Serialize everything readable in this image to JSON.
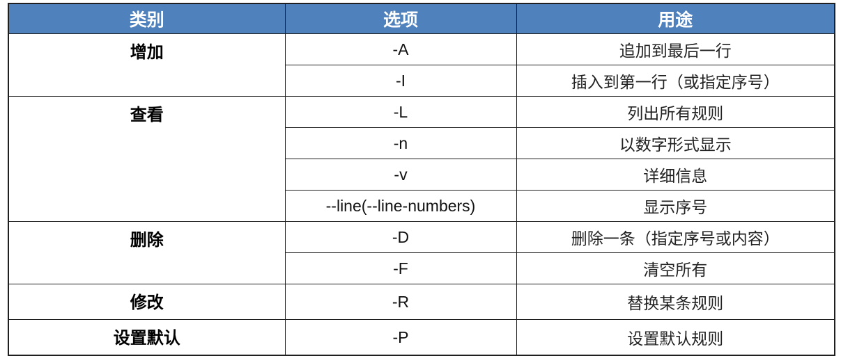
{
  "table": {
    "headers": [
      "类别",
      "选项",
      "用途"
    ],
    "colors": {
      "header_bg": "#4f81bd",
      "header_text": "#ffffff",
      "border": "#1f1f1f"
    },
    "groups": [
      {
        "category": "增加",
        "rows": [
          {
            "option": "-A",
            "purpose": "追加到最后一行"
          },
          {
            "option": "-I",
            "purpose": "插入到第一行（或指定序号）"
          }
        ]
      },
      {
        "category": "查看",
        "rows": [
          {
            "option": "-L",
            "purpose": "列出所有规则"
          },
          {
            "option": "-n",
            "purpose": "以数字形式显示"
          },
          {
            "option": "-v",
            "purpose": "详细信息"
          },
          {
            "option": "--line(--line-numbers)",
            "purpose": "显示序号"
          }
        ]
      },
      {
        "category": "删除",
        "rows": [
          {
            "option": "-D",
            "purpose": "删除一条（指定序号或内容）"
          },
          {
            "option": "-F",
            "purpose": "清空所有"
          }
        ]
      },
      {
        "category": "修改",
        "rows": [
          {
            "option": "-R",
            "purpose": "替换某条规则"
          }
        ]
      },
      {
        "category": "设置默认",
        "rows": [
          {
            "option": "-P",
            "purpose": "设置默认规则"
          }
        ]
      }
    ]
  }
}
